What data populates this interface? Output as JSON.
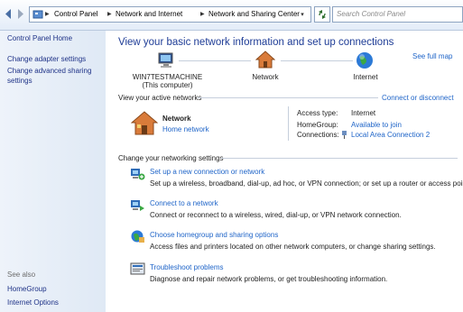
{
  "address_bar": {
    "breadcrumbs": [
      "Control Panel",
      "Network and Internet",
      "Network and Sharing Center"
    ],
    "search_placeholder": "Search Control Panel"
  },
  "sidebar": {
    "home": "Control Panel Home",
    "items": [
      "Change adapter settings",
      "Change advanced sharing",
      "settings"
    ],
    "see_also_label": "See also",
    "see_also": [
      "HomeGroup",
      "Internet Options"
    ]
  },
  "main": {
    "title": "View your basic network information and set up connections",
    "see_full_map": "See full map",
    "map": {
      "computer_name": "WIN7TESTMACHINE",
      "computer_sub": "(This computer)",
      "network_label": "Network",
      "internet_label": "Internet"
    },
    "active_networks": {
      "header": "View your active networks",
      "connect_link": "Connect or disconnect",
      "network_name": "Network",
      "network_type": "Home network",
      "access_type_label": "Access type:",
      "access_type_value": "Internet",
      "homegroup_label": "HomeGroup:",
      "homegroup_value": "Available to join",
      "connections_label": "Connections:",
      "connections_value": "Local Area Connection 2"
    },
    "settings": {
      "header": "Change your networking settings",
      "items": [
        {
          "title": "Set up a new connection or network",
          "desc": "Set up a wireless, broadband, dial-up, ad hoc, or VPN connection; or set up a router or access point."
        },
        {
          "title": "Connect to a network",
          "desc": "Connect or reconnect to a wireless, wired, dial-up, or VPN network connection."
        },
        {
          "title": "Choose homegroup and sharing options",
          "desc": "Access files and printers located on other network computers, or change sharing settings."
        },
        {
          "title": "Troubleshoot problems",
          "desc": "Diagnose and repair network problems, or get troubleshooting information."
        }
      ]
    }
  },
  "colors": {
    "link": "#1e64c8",
    "title": "#1e3c96",
    "sidebar_link": "#1e3287"
  }
}
